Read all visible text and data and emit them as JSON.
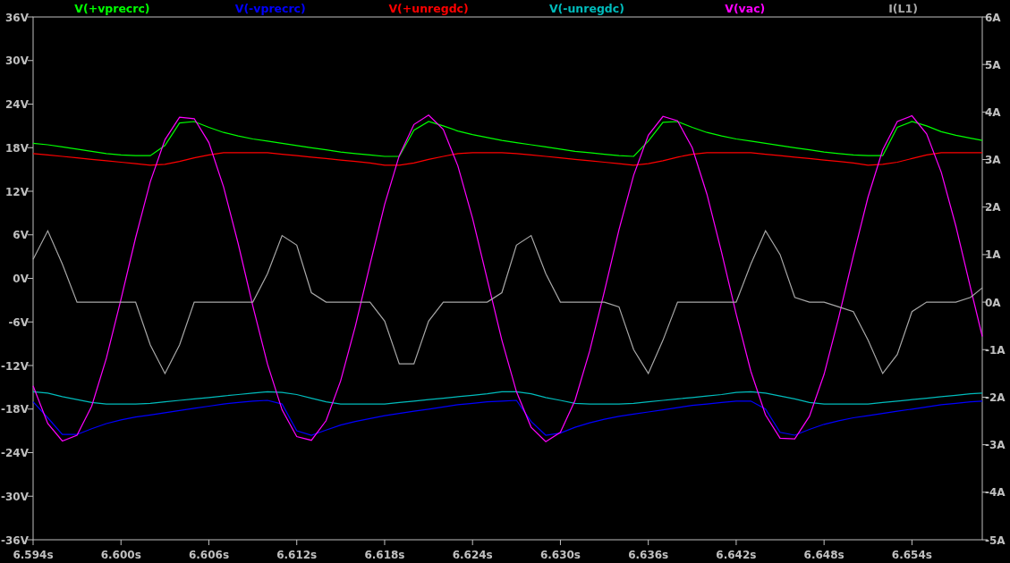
{
  "plot": {
    "chart_data": {
      "type": "line",
      "x": [
        6.594,
        6.595,
        6.596,
        6.597,
        6.598,
        6.599,
        6.6,
        6.601,
        6.602,
        6.603,
        6.604,
        6.605,
        6.606,
        6.607,
        6.608,
        6.609,
        6.61,
        6.611,
        6.612,
        6.613,
        6.614,
        6.615,
        6.616,
        6.617,
        6.618,
        6.619,
        6.62,
        6.621,
        6.622,
        6.623,
        6.624,
        6.625,
        6.626,
        6.627,
        6.628,
        6.629,
        6.63,
        6.631,
        6.632,
        6.633,
        6.634,
        6.635,
        6.636,
        6.637,
        6.638,
        6.639,
        6.64,
        6.641,
        6.642,
        6.643,
        6.644,
        6.645,
        6.646,
        6.647,
        6.648,
        6.649,
        6.65,
        6.651,
        6.652,
        6.653,
        6.654,
        6.655,
        6.656,
        6.657,
        6.658,
        6.6588
      ],
      "xlim": [
        6.594,
        6.6588
      ],
      "ylim": [
        -36,
        36
      ],
      "y2lim": [
        -5,
        6
      ],
      "xticks": [
        {
          "value": 6.594,
          "label": "6.594s"
        },
        {
          "value": 6.6,
          "label": "6.600s"
        },
        {
          "value": 6.606,
          "label": "6.606s"
        },
        {
          "value": 6.612,
          "label": "6.612s"
        },
        {
          "value": 6.618,
          "label": "6.618s"
        },
        {
          "value": 6.624,
          "label": "6.624s"
        },
        {
          "value": 6.63,
          "label": "6.630s"
        },
        {
          "value": 6.636,
          "label": "6.636s"
        },
        {
          "value": 6.642,
          "label": "6.642s"
        },
        {
          "value": 6.648,
          "label": "6.648s"
        },
        {
          "value": 6.654,
          "label": "6.654s"
        }
      ],
      "yticks": [
        {
          "value": 36,
          "label": "36V"
        },
        {
          "value": 30,
          "label": "30V"
        },
        {
          "value": 24,
          "label": "24V"
        },
        {
          "value": 18,
          "label": "18V"
        },
        {
          "value": 12,
          "label": "12V"
        },
        {
          "value": 6,
          "label": "6V"
        },
        {
          "value": 0,
          "label": "0V"
        },
        {
          "value": -6,
          "label": "-6V"
        },
        {
          "value": -12,
          "label": "-12V"
        },
        {
          "value": -18,
          "label": "-18V"
        },
        {
          "value": -24,
          "label": "-24V"
        },
        {
          "value": -30,
          "label": "-30V"
        },
        {
          "value": -36,
          "label": "-36V"
        }
      ],
      "y2ticks": [
        {
          "value": 6,
          "label": "6A"
        },
        {
          "value": 5,
          "label": "5A"
        },
        {
          "value": 4,
          "label": "4A"
        },
        {
          "value": 3,
          "label": "3A"
        },
        {
          "value": 2,
          "label": "2A"
        },
        {
          "value": 1,
          "label": "1A"
        },
        {
          "value": 0,
          "label": "0A"
        },
        {
          "value": -1,
          "label": "-1A"
        },
        {
          "value": -2,
          "label": "-2A"
        },
        {
          "value": -3,
          "label": "-3A"
        },
        {
          "value": -4,
          "label": "-4A"
        },
        {
          "value": -5,
          "label": "-5A"
        }
      ],
      "series": [
        {
          "name": "V(+vprecrc)",
          "color": "#00ff00",
          "values": [
            18.6,
            18.4,
            18.1,
            17.8,
            17.5,
            17.2,
            17.0,
            16.9,
            16.9,
            18.3,
            21.4,
            21.6,
            20.8,
            20.1,
            19.6,
            19.2,
            18.9,
            18.6,
            18.3,
            18.0,
            17.7,
            17.4,
            17.2,
            17.0,
            16.8,
            16.8,
            20.4,
            21.6,
            21.0,
            20.3,
            19.8,
            19.4,
            19.0,
            18.7,
            18.4,
            18.1,
            17.8,
            17.5,
            17.3,
            17.1,
            16.9,
            16.8,
            18.9,
            21.5,
            21.6,
            20.8,
            20.1,
            19.6,
            19.2,
            18.9,
            18.6,
            18.3,
            18.0,
            17.7,
            17.4,
            17.2,
            17.0,
            16.9,
            16.9,
            20.8,
            21.6,
            21.0,
            20.2,
            19.7,
            19.3,
            19.0
          ]
        },
        {
          "name": "V(-vprecrc)",
          "color": "#0000ff",
          "values": [
            -17.0,
            -19.2,
            -21.5,
            -21.5,
            -20.7,
            -20.0,
            -19.5,
            -19.1,
            -18.8,
            -18.5,
            -18.2,
            -17.9,
            -17.6,
            -17.3,
            -17.1,
            -16.9,
            -16.8,
            -17.3,
            -21.0,
            -21.6,
            -20.9,
            -20.2,
            -19.7,
            -19.3,
            -18.9,
            -18.6,
            -18.3,
            -18.0,
            -17.7,
            -17.4,
            -17.2,
            -17.0,
            -16.9,
            -16.8,
            -19.7,
            -21.6,
            -21.3,
            -20.5,
            -19.9,
            -19.4,
            -19.0,
            -18.7,
            -18.4,
            -18.1,
            -17.8,
            -17.5,
            -17.3,
            -17.1,
            -16.9,
            -16.9,
            -18.0,
            -21.2,
            -21.6,
            -20.8,
            -20.1,
            -19.6,
            -19.2,
            -18.9,
            -18.6,
            -18.3,
            -18.0,
            -17.7,
            -17.4,
            -17.2,
            -17.0,
            -16.9
          ]
        },
        {
          "name": "V(+unregdc)",
          "color": "#ff0000",
          "values": [
            17.2,
            17.0,
            16.8,
            16.6,
            16.4,
            16.2,
            16.0,
            15.8,
            15.6,
            15.7,
            16.1,
            16.6,
            17.0,
            17.3,
            17.3,
            17.3,
            17.3,
            17.1,
            16.9,
            16.7,
            16.5,
            16.3,
            16.1,
            15.9,
            15.6,
            15.6,
            15.9,
            16.4,
            16.8,
            17.2,
            17.3,
            17.3,
            17.3,
            17.2,
            17.0,
            16.8,
            16.6,
            16.4,
            16.2,
            16.0,
            15.8,
            15.6,
            15.8,
            16.2,
            16.7,
            17.1,
            17.3,
            17.3,
            17.3,
            17.3,
            17.1,
            16.9,
            16.7,
            16.5,
            16.3,
            16.1,
            15.9,
            15.6,
            15.7,
            16.0,
            16.5,
            17.0,
            17.3,
            17.3,
            17.3,
            17.3
          ]
        },
        {
          "name": "V(-unregdc)",
          "color": "#00bcbc",
          "values": [
            -15.6,
            -15.8,
            -16.3,
            -16.7,
            -17.1,
            -17.3,
            -17.3,
            -17.3,
            -17.2,
            -17.0,
            -16.8,
            -16.6,
            -16.4,
            -16.2,
            -16.0,
            -15.8,
            -15.6,
            -15.7,
            -16.0,
            -16.5,
            -17.0,
            -17.3,
            -17.3,
            -17.3,
            -17.3,
            -17.1,
            -16.9,
            -16.7,
            -16.5,
            -16.3,
            -16.1,
            -15.9,
            -15.6,
            -15.6,
            -15.9,
            -16.4,
            -16.8,
            -17.2,
            -17.3,
            -17.3,
            -17.3,
            -17.2,
            -17.0,
            -16.8,
            -16.6,
            -16.4,
            -16.2,
            -16.0,
            -15.7,
            -15.6,
            -15.8,
            -16.2,
            -16.6,
            -17.1,
            -17.3,
            -17.3,
            -17.3,
            -17.3,
            -17.1,
            -16.9,
            -16.7,
            -16.5,
            -16.3,
            -16.1,
            -15.9,
            -15.8
          ]
        },
        {
          "name": "V(vac)",
          "color": "#ff00ff",
          "values": [
            -14.8,
            -20.0,
            -22.4,
            -21.6,
            -17.6,
            -11.0,
            -2.9,
            5.6,
            13.3,
            19.1,
            22.2,
            22.0,
            18.7,
            12.6,
            4.8,
            -3.8,
            -11.8,
            -18.1,
            -21.8,
            -22.3,
            -19.6,
            -14.1,
            -6.6,
            1.9,
            10.2,
            16.9,
            21.2,
            22.5,
            20.5,
            15.5,
            8.3,
            -0.1,
            -8.5,
            -15.6,
            -20.5,
            -22.5,
            -21.2,
            -16.8,
            -10.0,
            -1.8,
            6.7,
            14.2,
            19.7,
            22.3,
            21.7,
            18.0,
            11.6,
            3.6,
            -4.9,
            -12.8,
            -18.8,
            -22.0,
            -22.1,
            -19.0,
            -13.2,
            -5.4,
            3.1,
            11.2,
            17.7,
            21.6,
            22.4,
            19.9,
            14.6,
            7.2,
            -1.3,
            -8.0
          ]
        },
        {
          "name": "I(L1)",
          "color": "#a8a8a8",
          "axis": "y2",
          "values": [
            0.9,
            1.5,
            0.8,
            0,
            0,
            0,
            0,
            0,
            -0.9,
            -1.5,
            -0.9,
            0,
            0,
            0,
            0,
            0,
            0.6,
            1.4,
            1.2,
            0.2,
            0,
            0,
            0,
            0,
            -0.4,
            -1.3,
            -1.3,
            -0.4,
            0,
            0,
            0,
            0,
            0.2,
            1.2,
            1.4,
            0.6,
            0,
            0,
            0,
            0,
            -0.1,
            -1.0,
            -1.5,
            -0.8,
            0,
            0,
            0,
            0,
            0,
            0.8,
            1.5,
            1.0,
            0.1,
            0,
            0,
            -0.1,
            -0.2,
            -0.8,
            -1.5,
            -1.1,
            -0.2,
            0,
            0,
            0,
            0.1,
            0.3
          ]
        }
      ]
    }
  }
}
